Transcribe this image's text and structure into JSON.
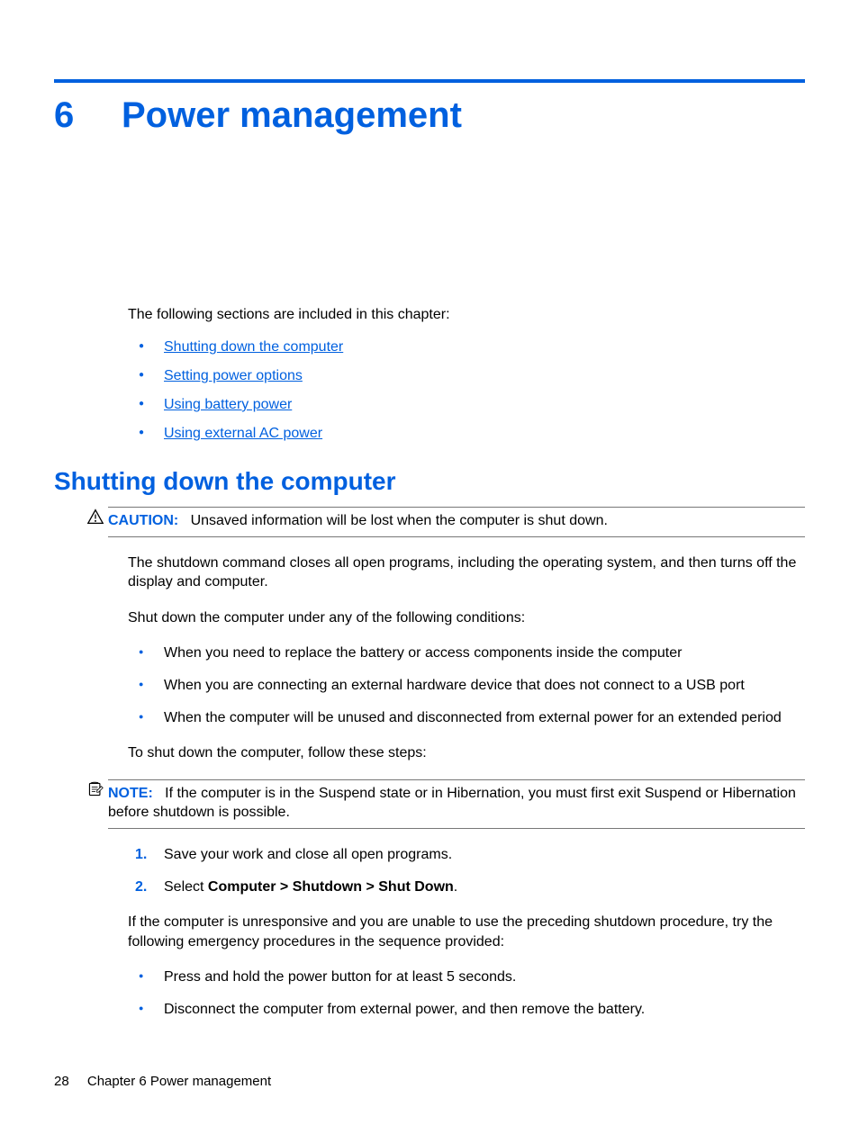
{
  "chapter": {
    "number": "6",
    "title": "Power management"
  },
  "intro": "The following sections are included in this chapter:",
  "toc_links": [
    "Shutting down the computer",
    "Setting power options",
    "Using battery power",
    "Using external AC power"
  ],
  "section": {
    "title": "Shutting down the computer",
    "caution_label": "CAUTION:",
    "caution_text": "Unsaved information will be lost when the computer is shut down.",
    "p1": "The shutdown command closes all open programs, including the operating system, and then turns off the display and computer.",
    "p2": "Shut down the computer under any of the following conditions:",
    "conditions": [
      "When you need to replace the battery or access components inside the computer",
      "When you are connecting an external hardware device that does not connect to a USB port",
      "When the computer will be unused and disconnected from external power for an extended period"
    ],
    "p3": "To shut down the computer, follow these steps:",
    "note_label": "NOTE:",
    "note_text": "If the computer is in the Suspend state or in Hibernation, you must first exit Suspend or Hibernation before shutdown is possible.",
    "steps": {
      "s1": "Save your work and close all open programs.",
      "s2_prefix": "Select ",
      "s2_bold": "Computer > Shutdown > Shut Down",
      "s2_suffix": "."
    },
    "p4": "If the computer is unresponsive and you are unable to use the preceding shutdown procedure, try the following emergency procedures in the sequence provided:",
    "emergency": [
      "Press and hold the power button for at least 5 seconds.",
      "Disconnect the computer from external power, and then remove the battery."
    ]
  },
  "footer": {
    "page": "28",
    "text": "Chapter 6   Power management"
  }
}
